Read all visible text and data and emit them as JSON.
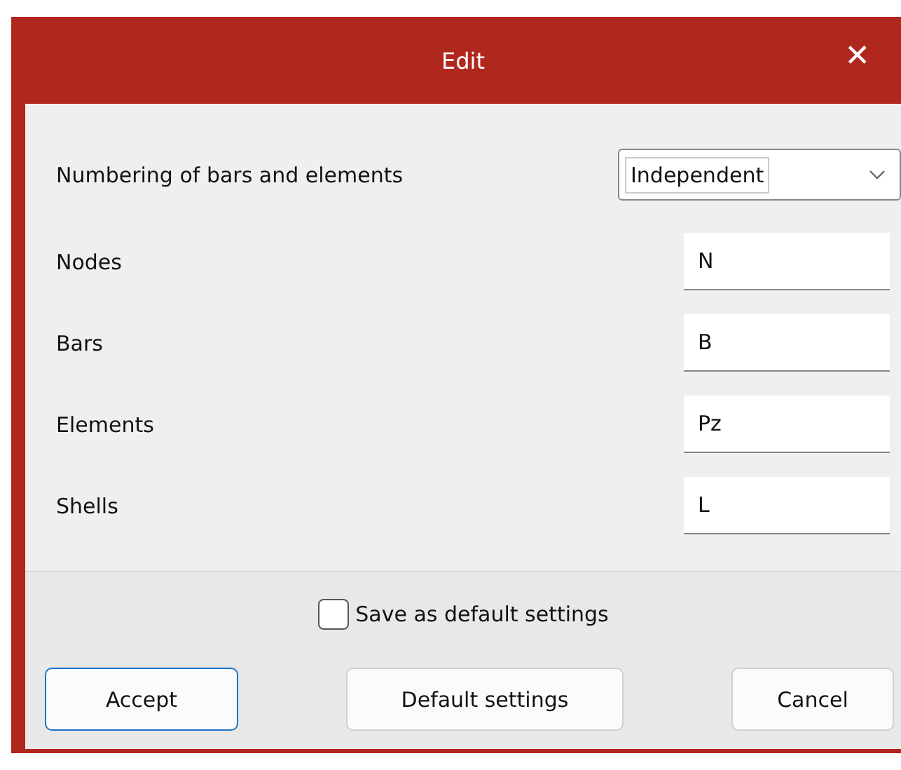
{
  "window": {
    "title": "Edit",
    "close": "✕"
  },
  "numbering": {
    "label": "Numbering of bars and elements",
    "value": "Independent"
  },
  "fields": [
    {
      "label": "Nodes",
      "value": "N"
    },
    {
      "label": "Bars",
      "value": "B"
    },
    {
      "label": "Elements",
      "value": "Pz"
    },
    {
      "label": "Shells",
      "value": "L"
    }
  ],
  "save_default": {
    "label": "Save as default settings",
    "checked": false
  },
  "buttons": [
    {
      "label": "Accept",
      "default": true
    },
    {
      "label": "Default settings",
      "default": false
    },
    {
      "label": "Cancel",
      "default": false
    }
  ]
}
